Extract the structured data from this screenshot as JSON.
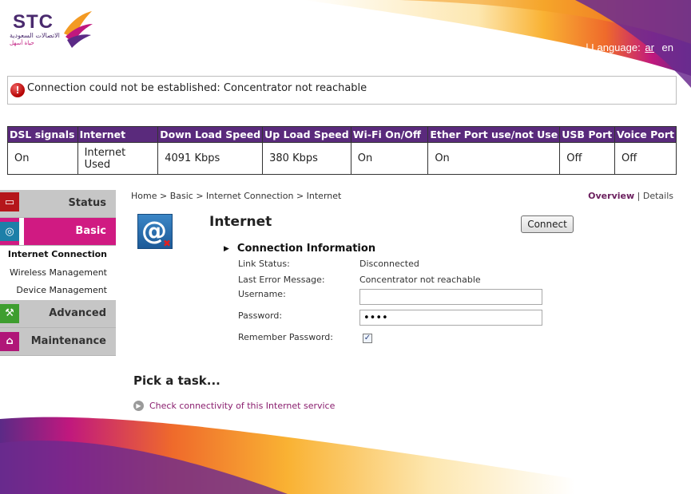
{
  "brand": {
    "logo_text": "STC",
    "logo_ar_line1": "الاتصالات السعودية",
    "logo_ar_line2": "حياة أسهل"
  },
  "language": {
    "label": "Language:",
    "options": [
      "ar",
      "en"
    ]
  },
  "alert": {
    "message": "Connection could not be established: Concentrator not reachable"
  },
  "status_table": {
    "headers": [
      "DSL signals",
      "Internet",
      "Down Load Speed",
      "Up Load Speed",
      "Wi-Fi On/Off",
      "Ether Port use/not Use",
      "USB Port",
      "Voice Port"
    ],
    "values": [
      "On",
      "Internet Used",
      "4091 Kbps",
      "380 Kbps",
      "On",
      "On",
      "Off",
      "Off"
    ]
  },
  "sidebar": {
    "status": "Status",
    "basic": "Basic",
    "basic_sub": [
      "Internet Connection",
      "Wireless Management",
      "Device Management"
    ],
    "advanced": "Advanced",
    "maintenance": "Maintenance"
  },
  "breadcrumb": "Home > Basic > Internet Connection > Internet",
  "view": {
    "overview": "Overview",
    "separator": "|",
    "details": "Details"
  },
  "service": {
    "title": "Internet",
    "connect_label": "Connect",
    "section_title": "Connection Information",
    "link_status_label": "Link Status:",
    "link_status_value": "Disconnected",
    "last_error_label": "Last Error Message:",
    "last_error_value": "Concentrator not reachable",
    "username_label": "Username:",
    "username_value": "",
    "password_label": "Password:",
    "password_value": "abcd",
    "remember_label": "Remember Password:",
    "remember_checked": true
  },
  "tasks": {
    "title": "Pick a task...",
    "items": [
      "Check connectivity of this Internet service"
    ]
  },
  "colors": {
    "header_purple": "#5a2a7c",
    "active_magenta": "#d01a82",
    "link": "#8a1e6e"
  }
}
